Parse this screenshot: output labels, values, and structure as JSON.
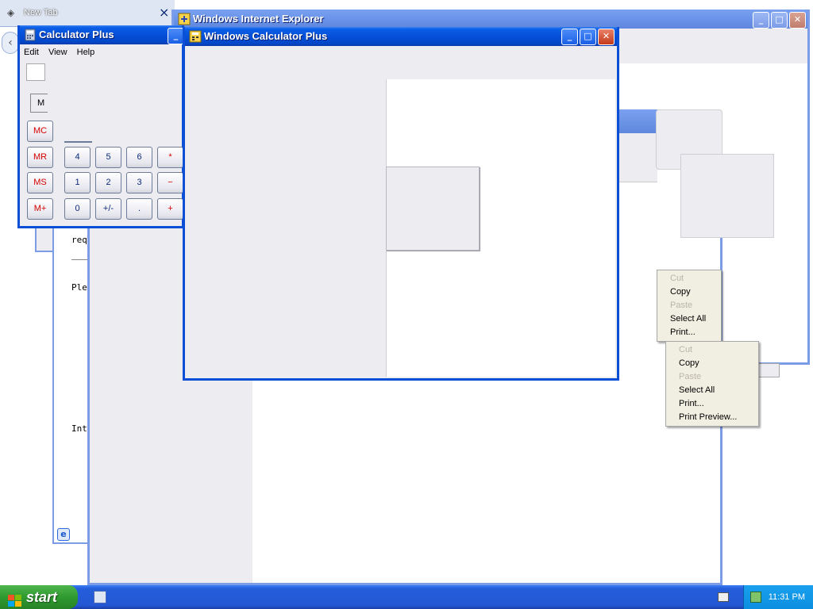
{
  "background_tab": {
    "title": "New Tab",
    "close": "×"
  },
  "ie_window": {
    "title": "Windows Internet Explorer"
  },
  "calc_small": {
    "title": "Calculator Plus",
    "menu": [
      "Edit",
      "View",
      "Help"
    ],
    "memory_label": "M",
    "buttons": {
      "mc": "MC",
      "mr": "MR",
      "ms": "MS",
      "mplus": "M+",
      "b4": "4",
      "b5": "5",
      "b6": "6",
      "mul": "*",
      "b1": "1",
      "b2": "2",
      "b3": "3",
      "minus": "−",
      "b0": "0",
      "sign": "+/-",
      "dot": ".",
      "plus": "+"
    }
  },
  "calc_main": {
    "title": "Windows Calculator Plus"
  },
  "bg_text": {
    "line1": "req",
    "line2": "Plea",
    "line3": "Inte"
  },
  "context_menu_1": {
    "items": [
      "Cut",
      "Copy",
      "Paste",
      "Select All",
      "Print..."
    ]
  },
  "context_menu_2": {
    "items": [
      "Cut",
      "Copy",
      "Paste",
      "Select All",
      "Print...",
      "Print Preview..."
    ]
  },
  "taskbar": {
    "start_label": "start",
    "clock": "11:31 PM"
  },
  "colors": {
    "title_active": "#0550d8",
    "taskbar": "#245edb",
    "start_green": "#2f9a2f",
    "calc_red": "#d40000"
  }
}
